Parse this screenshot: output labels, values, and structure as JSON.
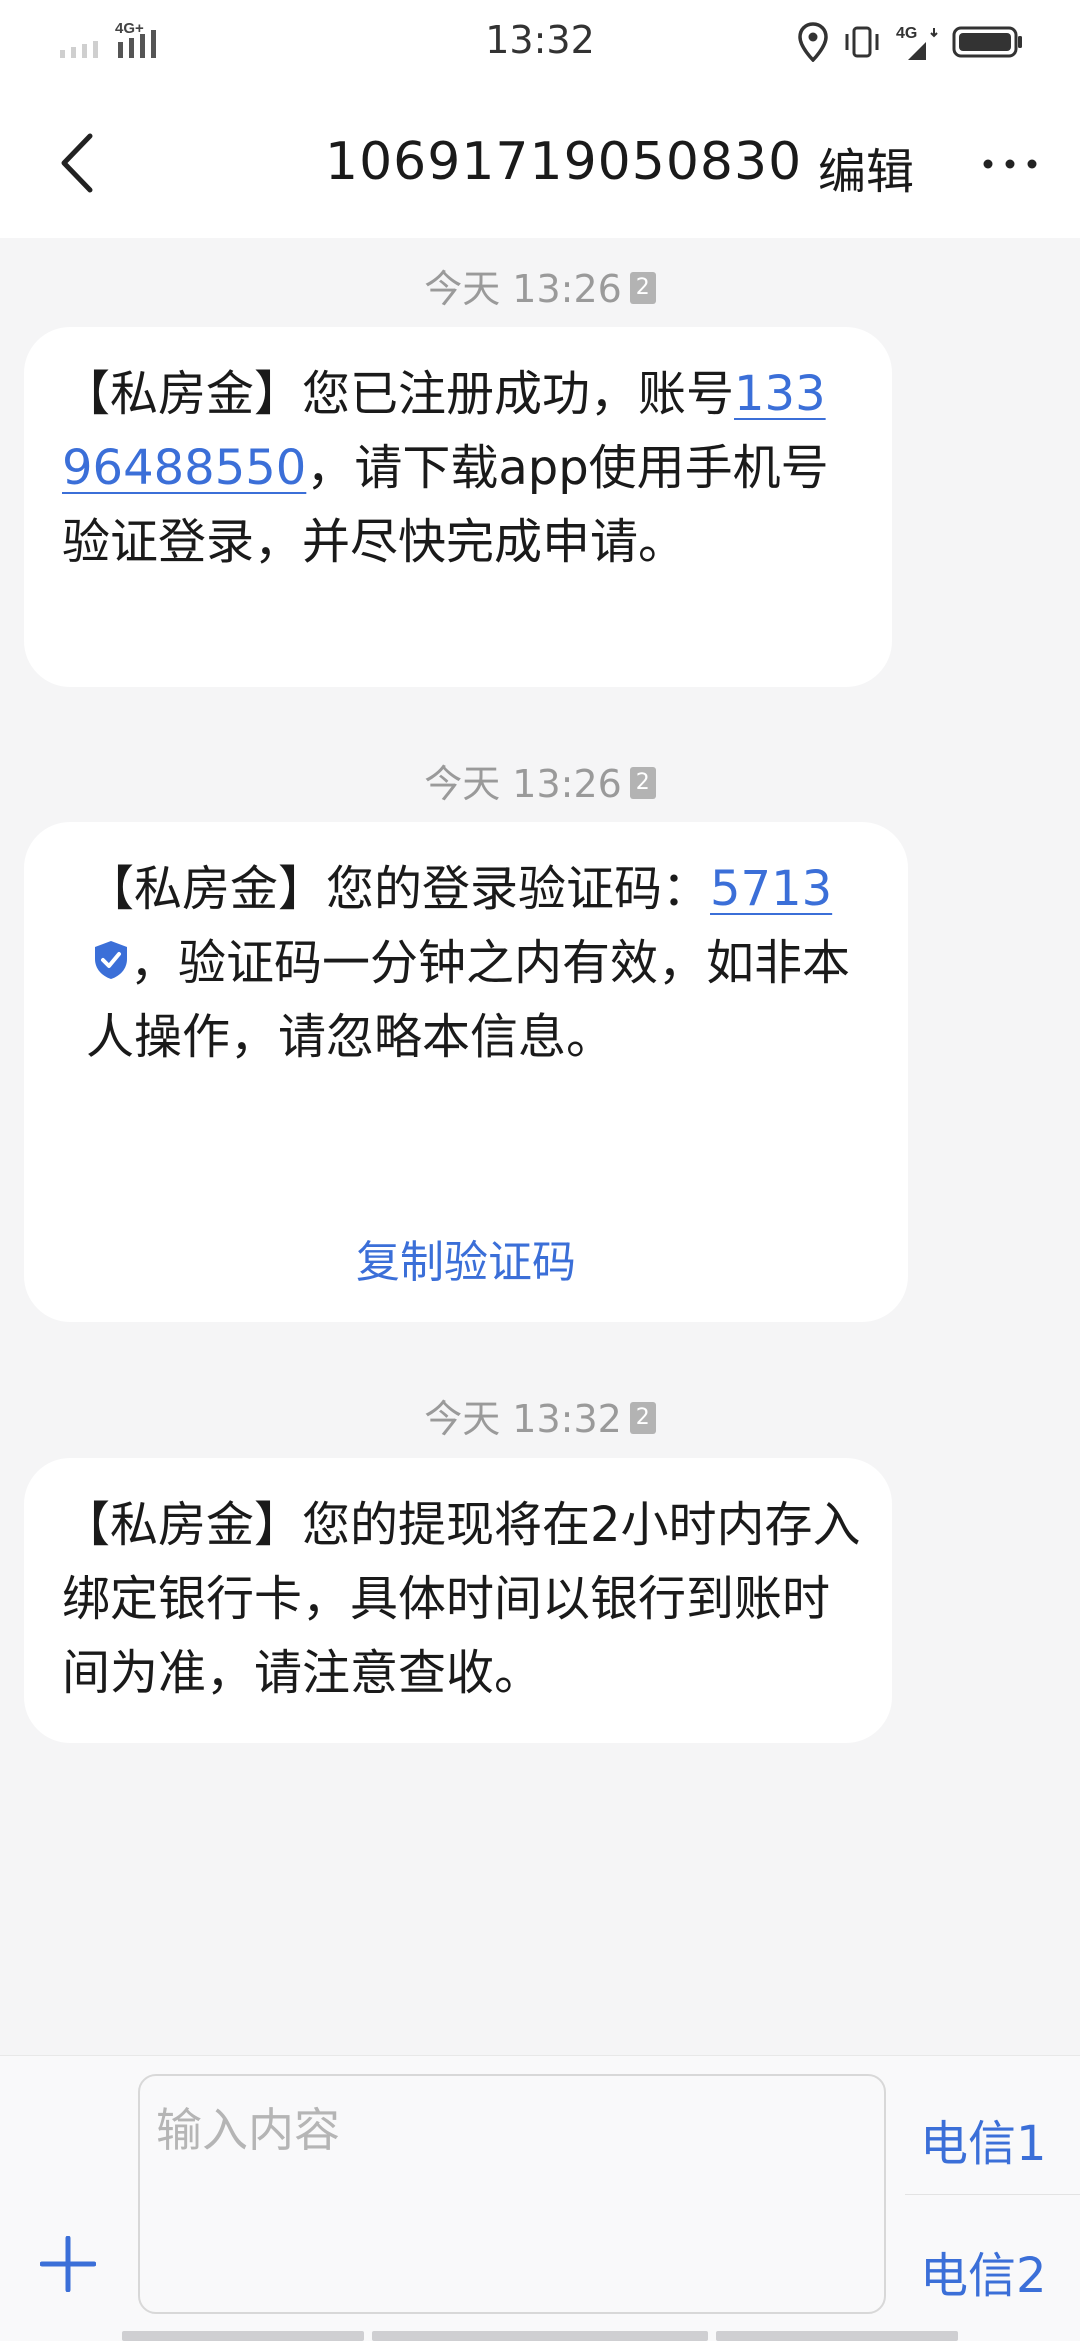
{
  "status": {
    "time": "13:32",
    "left_network": "4G+",
    "right_network": "4G"
  },
  "nav": {
    "title": "10691719050830",
    "edit_label": "编辑"
  },
  "messages": [
    {
      "timestamp": "今天 13:26",
      "sim": "2",
      "text_before": "【私房金】您已注册成功，账号",
      "link": "13396488550",
      "text_after": "，请下载app使用手机号验证登录，并尽快完成申请。"
    },
    {
      "timestamp": "今天 13:26",
      "sim": "2",
      "text_before": "【私房金】您的登录验证码：",
      "code": "5713",
      "text_after": "，验证码一分钟之内有效，如非本人操作，请忽略本信息。",
      "copy_label": "复制验证码"
    },
    {
      "timestamp": "今天 13:32",
      "sim": "2",
      "text": "【私房金】您的提现将在2小时内存入绑定银行卡，具体时间以银行到账时间为准，请注意查收。"
    }
  ],
  "composer": {
    "placeholder": "输入内容",
    "sim1_label": "电信1",
    "sim2_label": "电信2"
  }
}
